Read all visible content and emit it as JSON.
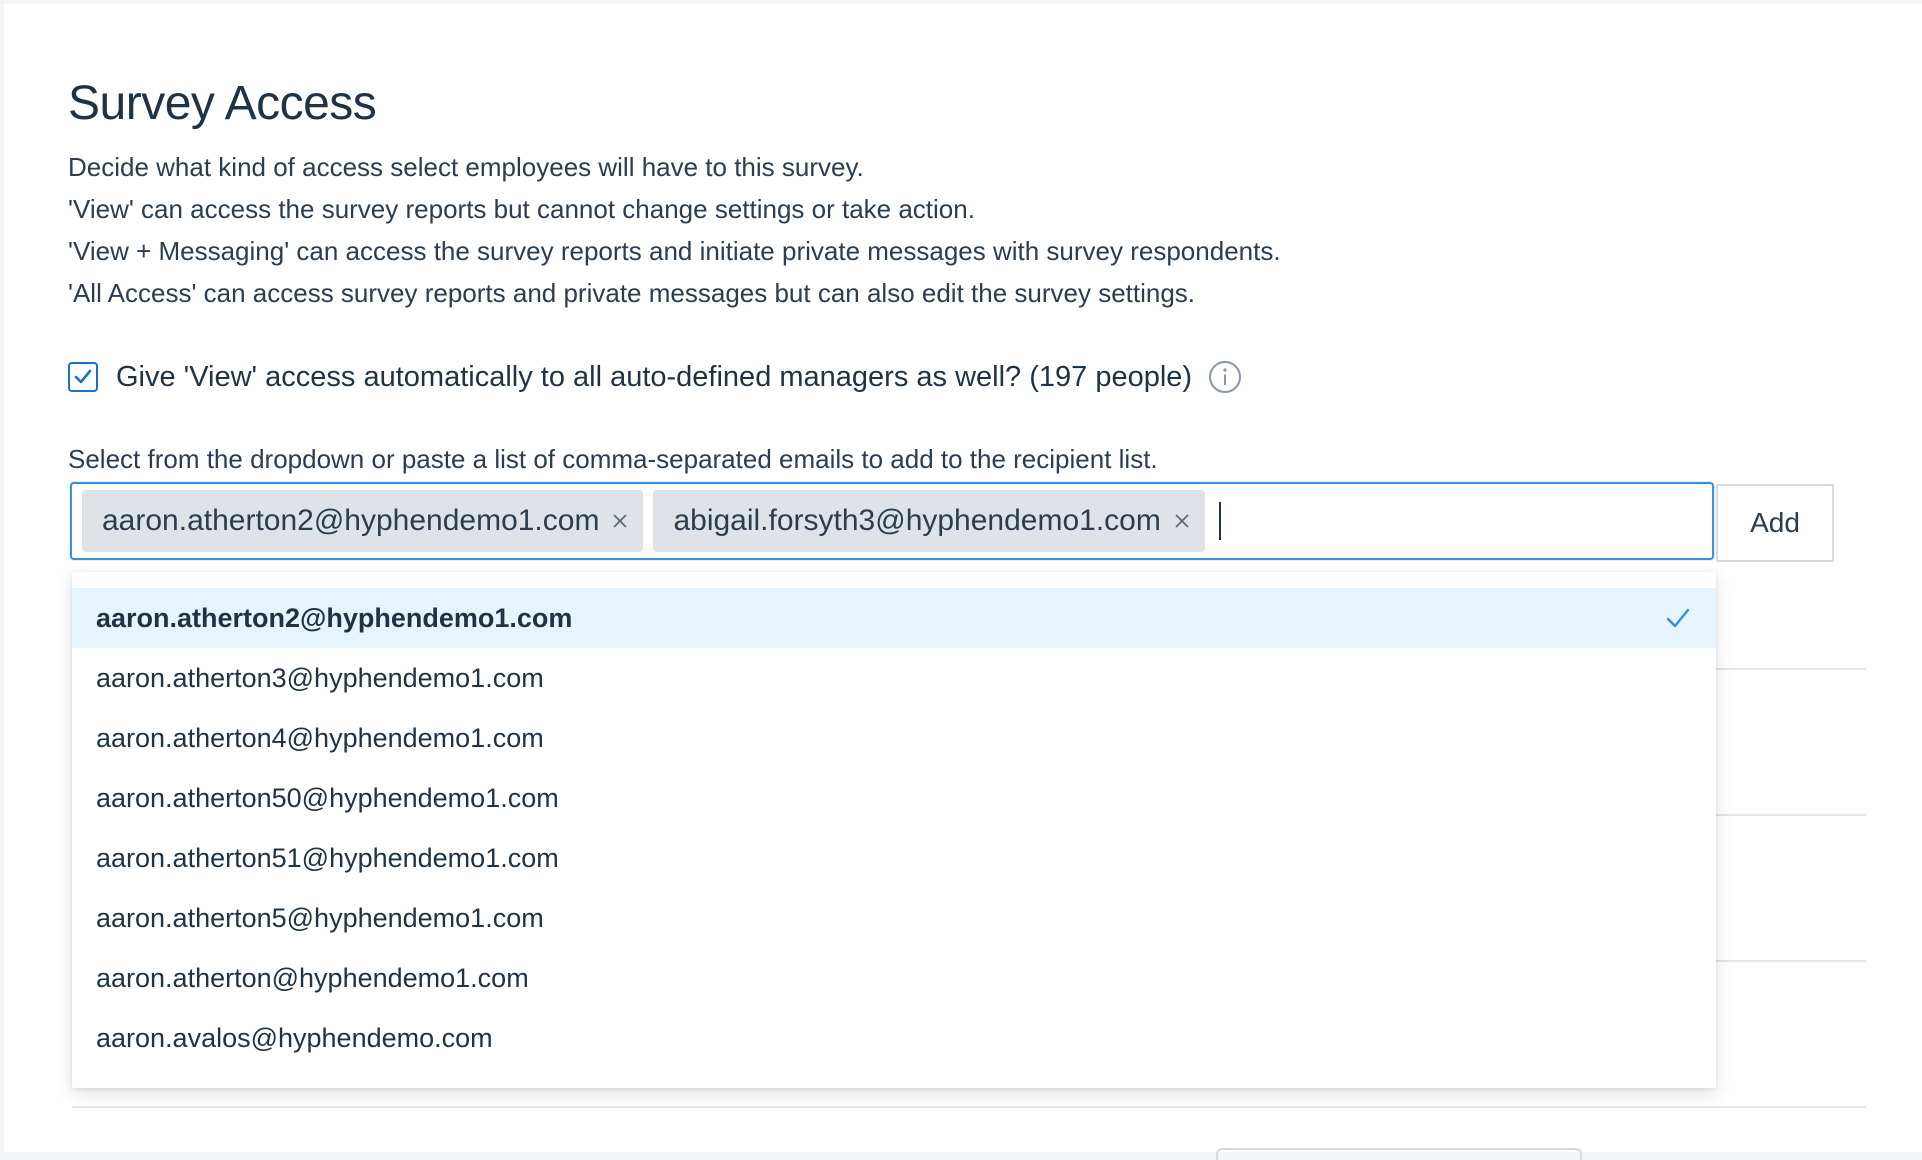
{
  "title": "Survey Access",
  "description": [
    "Decide what kind of access select employees will have to this survey.",
    "'View' can access the survey reports but cannot change settings or take action.",
    "'View + Messaging' can access the survey reports and initiate private messages with survey respondents.",
    "'All Access' can access survey reports and private messages but can also edit the survey settings."
  ],
  "auto_manager": {
    "checked": true,
    "label": "Give 'View' access automatically to all auto-defined managers as well? (197 people)",
    "icon": "info-icon"
  },
  "recipients": {
    "helper": "Select from the dropdown or paste a list of comma-separated emails to add to the recipient list.",
    "tags": [
      "aaron.atherton2@hyphendemo1.com",
      "abigail.forsyth3@hyphendemo1.com"
    ],
    "input_value": "",
    "add_label": "Add"
  },
  "dropdown": {
    "options": [
      "aaron.atherton2@hyphendemo1.com",
      "aaron.atherton3@hyphendemo1.com",
      "aaron.atherton4@hyphendemo1.com",
      "aaron.atherton50@hyphendemo1.com",
      "aaron.atherton51@hyphendemo1.com",
      "aaron.atherton5@hyphendemo1.com",
      "aaron.atherton@hyphendemo1.com",
      "aaron.avalos@hyphendemo.com"
    ],
    "selected_index": 0
  },
  "colors": {
    "accent": "#3b8fe0",
    "checkbox": "#1f6fc5",
    "selected_bg": "#e6f4fd",
    "tag_bg": "#dfe3e8",
    "text": "#1f3345"
  }
}
